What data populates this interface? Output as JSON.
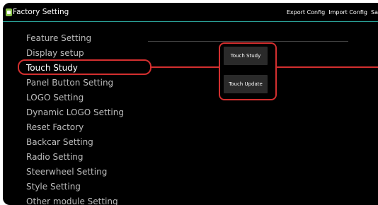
{
  "header": {
    "title": "Factory Setting",
    "actions": [
      "Export Config",
      "Import Config",
      "Sa"
    ]
  },
  "menu": {
    "items": [
      "Feature Setting",
      "Display setup",
      "Touch Study",
      "Panel Button Setting",
      "LOGO Setting",
      "Dynamic LOGO Setting",
      "Reset Factory",
      "Backcar Setting",
      "Radio Setting",
      "Steerwheel Setting",
      "Style Setting",
      "Other module Setting"
    ],
    "selected": "Touch Study"
  },
  "content": {
    "buttons": [
      "Touch Study",
      "Touch Update"
    ]
  },
  "colors": {
    "highlight": "#d32f2f",
    "header_line": "#2aa198"
  }
}
